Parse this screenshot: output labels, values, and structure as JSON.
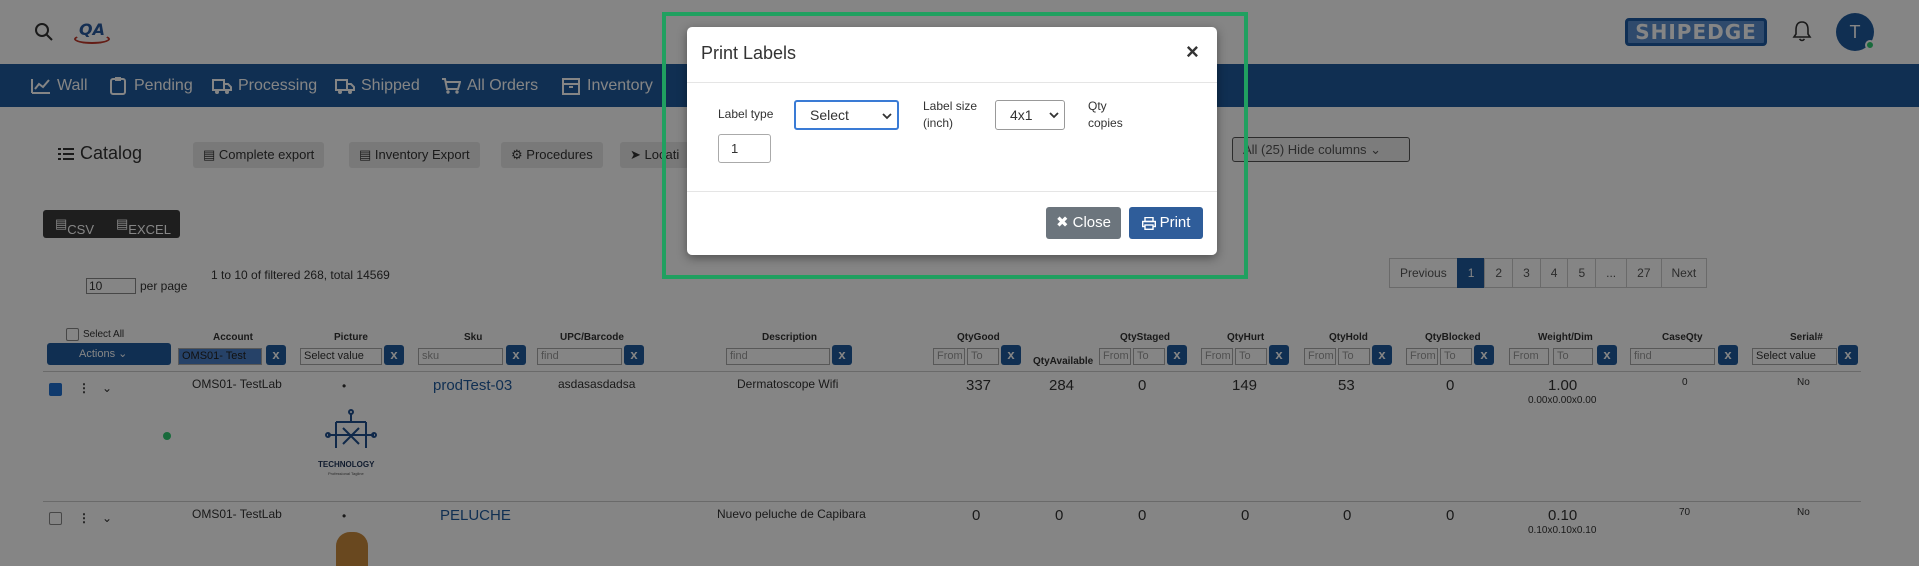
{
  "header": {
    "logo_text": "QA",
    "brand_text": "SHIPEDGE",
    "avatar_initial": "T"
  },
  "nav": {
    "items": [
      {
        "label": "Wall",
        "icon": "chart-icon"
      },
      {
        "label": "Pending",
        "icon": "clipboard-icon"
      },
      {
        "label": "Processing",
        "icon": "truck-icon"
      },
      {
        "label": "Shipped",
        "icon": "truck-icon"
      },
      {
        "label": "All Orders",
        "icon": "cart-icon"
      },
      {
        "label": "Inventory",
        "icon": "archive-icon"
      }
    ]
  },
  "toolbar": {
    "catalog_label": "Catalog",
    "complete_export": "Complete export",
    "inventory_export": "Inventory Export",
    "procedures": "Procedures",
    "locations": "Locati",
    "hide_columns": "All (25)  Hide columns",
    "csv": "CSV",
    "excel": "EXCEL"
  },
  "listing": {
    "per_page_value": "10",
    "per_page_label": "per page",
    "filtered_text": "1 to 10 of filtered 268, total 14569"
  },
  "pagination": [
    "Previous",
    "1",
    "2",
    "3",
    "4",
    "5",
    "...",
    "27",
    "Next"
  ],
  "table": {
    "select_all": "Select All",
    "actions": "Actions",
    "headers": {
      "account": "Account",
      "picture": "Picture",
      "sku": "Sku",
      "upc": "UPC/Barcode",
      "description": "Description",
      "qty_good": "QtyGood",
      "qty_available": "QtyAvailable",
      "qty_staged": "QtyStaged",
      "qty_hurt": "QtyHurt",
      "qty_hold": "QtyHold",
      "qty_blocked": "QtyBlocked",
      "weight_dim": "Weight/Dim",
      "case_qty": "CaseQty",
      "serial": "Serial#"
    },
    "filters": {
      "account_value": "OMS01- Test",
      "select_value": "Select value",
      "sku_placeholder": "sku",
      "find_placeholder": "find",
      "from_placeholder": "From",
      "to_placeholder": "To",
      "clear": "x"
    },
    "rows": [
      {
        "account": "OMS01- TestLab",
        "picture_dot": "•",
        "sku": "prodTest-03",
        "upc": "asdasasdadsa",
        "description": "Dermatoscope Wifi",
        "qty_good": "337",
        "qty_available": "284",
        "qty_staged": "0",
        "qty_hurt": "149",
        "qty_hold": "53",
        "qty_blocked": "0",
        "weight": "1.00",
        "dim": "0.00x0.00x0.00",
        "case_qty": "0",
        "serial": "No",
        "logo_text": "TECHNOLOGY",
        "logo_sub": "Professional Tagline"
      },
      {
        "account": "OMS01- TestLab",
        "picture_dot": "•",
        "sku": "PELUCHE",
        "upc": "",
        "description": "Nuevo peluche de Capibara",
        "qty_good": "0",
        "qty_available": "0",
        "qty_staged": "0",
        "qty_hurt": "0",
        "qty_hold": "0",
        "qty_blocked": "0",
        "weight": "0.10",
        "dim": "0.10x0.10x0.10",
        "case_qty": "70",
        "serial": "No"
      }
    ]
  },
  "modal": {
    "title": "Print Labels",
    "close_x": "×",
    "label_type_label": "Label type",
    "label_type_value": "Select",
    "label_size_label": "Label size (inch)",
    "label_size_value": "4x1",
    "qty_copies_label": "Qty copies",
    "qty_copies_value": "1",
    "close_button": "Close",
    "print_button": "Print"
  },
  "colors": {
    "primary": "#1f5b9e",
    "highlight": "#20a060",
    "close_button": "#6c757d",
    "print_button": "#2f5d9a"
  }
}
